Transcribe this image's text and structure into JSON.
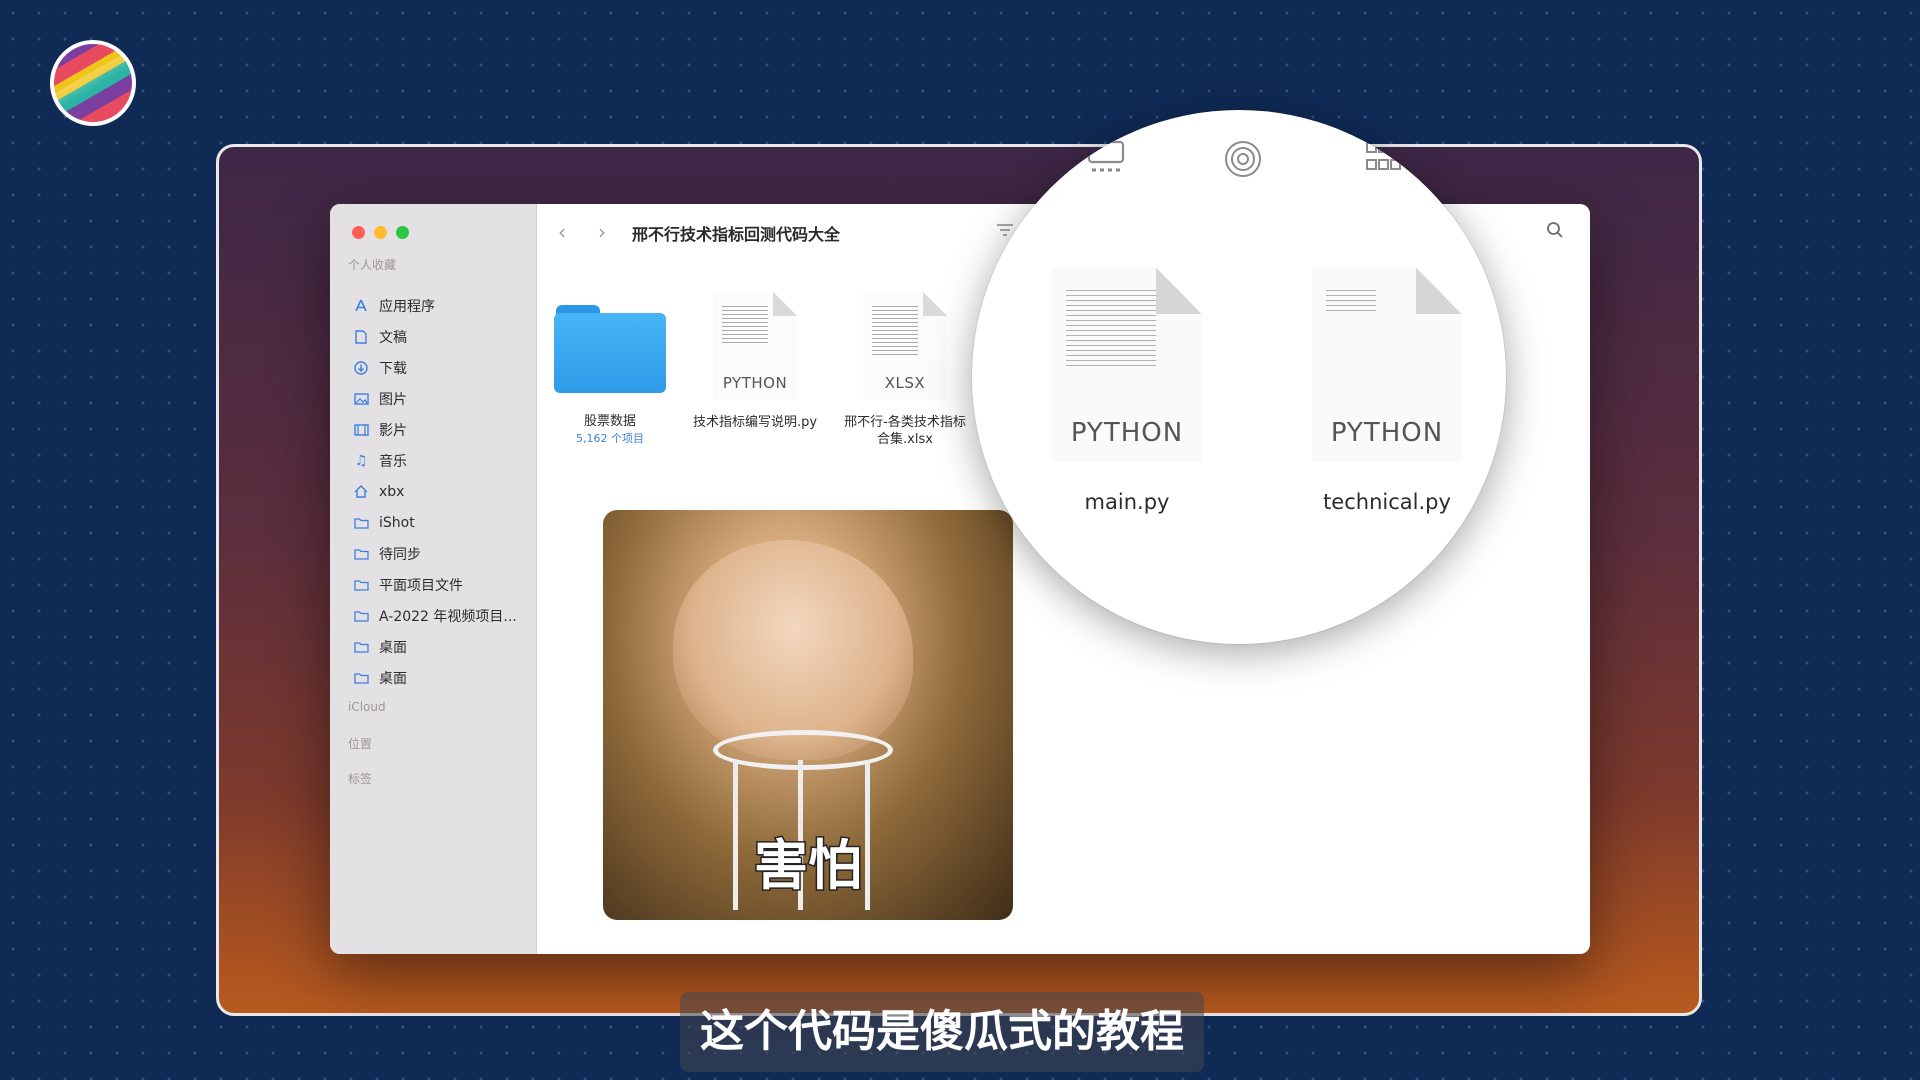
{
  "window": {
    "title": "邢不行技术指标回测代码大全",
    "back_glyph": "‹",
    "forward_glyph": "›"
  },
  "sidebar": {
    "favorites_header": "个人收藏",
    "items": [
      {
        "label": "应用程序",
        "icon": "apps-icon"
      },
      {
        "label": "文稿",
        "icon": "document-icon"
      },
      {
        "label": "下载",
        "icon": "download-icon"
      },
      {
        "label": "图片",
        "icon": "photo-icon"
      },
      {
        "label": "影片",
        "icon": "film-icon"
      },
      {
        "label": "音乐",
        "icon": "music-icon"
      },
      {
        "label": "xbx",
        "icon": "home-icon"
      },
      {
        "label": "iShot",
        "icon": "folder-icon"
      },
      {
        "label": "待同步",
        "icon": "folder-icon"
      },
      {
        "label": "平面项目文件",
        "icon": "folder-icon"
      },
      {
        "label": "A-2022 年视频项目...",
        "icon": "folder-icon"
      },
      {
        "label": "桌面",
        "icon": "folder-icon"
      },
      {
        "label": "桌面",
        "icon": "folder-icon"
      }
    ],
    "icloud_header": "iCloud",
    "locations_header": "位置",
    "tags_header": "标签"
  },
  "files": [
    {
      "name": "股票数据",
      "sub": "5,162 个项目",
      "kind": "folder"
    },
    {
      "name": "技术指标编写说明.py",
      "tag": "PYTHON",
      "kind": "doc"
    },
    {
      "name_line1": "邢不行-各类技术指标",
      "name_line2": "合集.xlsx",
      "tag": "XLSX",
      "kind": "doc"
    }
  ],
  "magnified": {
    "files": [
      {
        "name": "main.py",
        "tag": "PYTHON"
      },
      {
        "name": "technical.py",
        "tag": "PYTHON"
      }
    ]
  },
  "meme": {
    "caption": "害怕"
  },
  "subtitle": "这个代码是傻瓜式的教程",
  "colors": {
    "accent": "#3d7fe0",
    "folder": "#47b5f5",
    "background": "#0f2a55"
  }
}
